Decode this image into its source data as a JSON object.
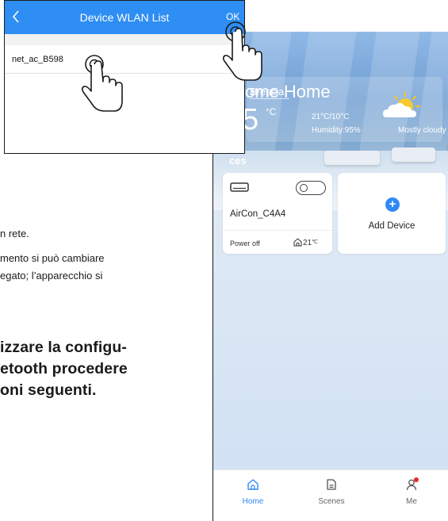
{
  "wlan": {
    "title": "Device WLAN List",
    "ok_label": "OK",
    "network": "net_ac_B598",
    "back_icon": "chevron-left-icon"
  },
  "home": {
    "title": "ome Home",
    "weather": {
      "city": "Brescia",
      "temp": "5",
      "unit": "°C",
      "range": "21°C/10°C",
      "humidity": "Humidity:95%",
      "description": "Mostly cloudy",
      "icon": "partly-cloudy-icon"
    },
    "devices_label": "ces",
    "device": {
      "name": "AirCon_C4A4",
      "status": "Power off",
      "temp": "21",
      "temp_unit": "℃",
      "icon": "air-conditioner-icon"
    },
    "add_device": "Add Device",
    "tabs": [
      {
        "label": "Home",
        "icon": "home-icon"
      },
      {
        "label": "Scenes",
        "icon": "scenes-icon"
      },
      {
        "label": "Me",
        "icon": "user-icon"
      }
    ]
  },
  "manual": {
    "line1": "n rete.",
    "line2": "mento si può cambiare",
    "line3": "egato; l’apparecchio si",
    "bold1": "izzare la configu-",
    "bold2": "etooth procedere",
    "bold3": "oni seguenti."
  },
  "colors": {
    "accent": "#2e8ef4",
    "notification": "#e2282d"
  }
}
